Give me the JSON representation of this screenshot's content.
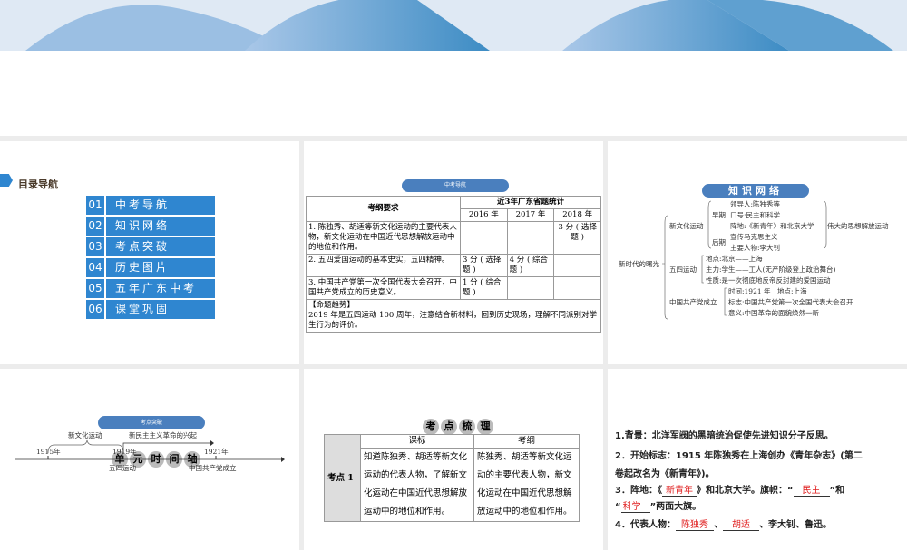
{
  "toc": {
    "title": "目录导航",
    "items": [
      {
        "num": "01",
        "label": "中考导航"
      },
      {
        "num": "02",
        "label": "知识网络"
      },
      {
        "num": "03",
        "label": "考点突破"
      },
      {
        "num": "04",
        "label": "历史图片"
      },
      {
        "num": "05",
        "label": "五年广东中考"
      },
      {
        "num": "06",
        "label": "课堂巩固"
      }
    ]
  },
  "nav": {
    "pill": "中考导航",
    "h_req": "考纲要求",
    "h_stat": "近3年广东省题统计",
    "years": [
      "2016 年",
      "2017 年",
      "2018 年"
    ],
    "rows": [
      {
        "req": "1. 陈独秀、胡适等新文化运动的主要代表人物，新文化运动在中国近代思想解放运动中的地位和作用。",
        "c": [
          "",
          "",
          "3 分 ( 选择题 )"
        ]
      },
      {
        "req": "2. 五四爱国运动的基本史实，五四精神。",
        "c": [
          "3 分 ( 选择题 )",
          "4 分 ( 综合题 )",
          ""
        ]
      },
      {
        "req": "3. 中国共产党第一次全国代表大会召开，中国共产党成立的历史意义。",
        "c": [
          "1 分 ( 综合题 )",
          "",
          ""
        ]
      }
    ],
    "trend_title": "【命题趋势】",
    "trend": "2019 年是五四运动 100 周年，注意结合新材料，回到历史现场，理解不同派别对学生行为的评价。"
  },
  "network": {
    "pill": "知识网络",
    "root": "新时代的曙光",
    "b1": "新文化运动",
    "early": "早期",
    "late": "后期",
    "e": [
      "领导人:陈独秀等",
      "口号:民主和科学",
      "阵地:《新青年》和北京大学"
    ],
    "l": [
      "宣传马克思主义",
      "主要人物:李大钊"
    ],
    "result": "伟大的思想解放运动",
    "b2": "五四运动",
    "m": [
      "地点:北京——上海",
      "主力:学生——工人(无产阶级登上政治舞台)",
      "性质:是一次彻底地反帝反封建的爱国运动"
    ],
    "b3": "中国共产党成立",
    "c": [
      "时间:1921 年　地点:上海",
      "标志:中国共产党第一次全国代表大会召开",
      "意义:中国革命的面貌焕然一新"
    ]
  },
  "timeline": {
    "pill": "考点突破",
    "title": [
      "单",
      "元",
      "时",
      "间",
      "轴"
    ],
    "span1": "新文化运动",
    "span2": "新民主主义革命的兴起",
    "years": [
      "1915年",
      "1919年",
      "1921年"
    ],
    "events": [
      "五四运动",
      "中国共产党成立"
    ]
  },
  "review": {
    "title": [
      "考",
      "点",
      "梳",
      "理"
    ],
    "h1": "课标",
    "h2": "考纲",
    "row": "考点 1",
    "c1": "知道陈独秀、胡适等新文化运动的代表人物，了解新文化运动在中国近代思想解放运动中的地位和作用。",
    "c2": "陈独秀、胡适等新文化运动的主要代表人物，新文化运动在中国近代思想解放运动中的地位和作用。"
  },
  "notes": {
    "l1": "1.背景：北洋军阀的黑暗统治促使先进知识分子反思。",
    "l2a": "2．开始标志：1915 年陈独秀在上海创办《青年杂志》(第二",
    "l2b": "卷起改名为《新青年》)。",
    "l3a": "3．阵地：《",
    "a1": "新青年",
    "l3b": "》和北京大学。旗帜：“",
    "a2": "民主",
    "l3c": "”和",
    "l4a": "“",
    "a3": "科学",
    "l4b": "”两面大旗。",
    "l5a": "4．代表人物：",
    "a4": "陈独秀",
    "sep": "、",
    "a5": "胡适",
    "l5b": "、李大钊、鲁迅。"
  }
}
